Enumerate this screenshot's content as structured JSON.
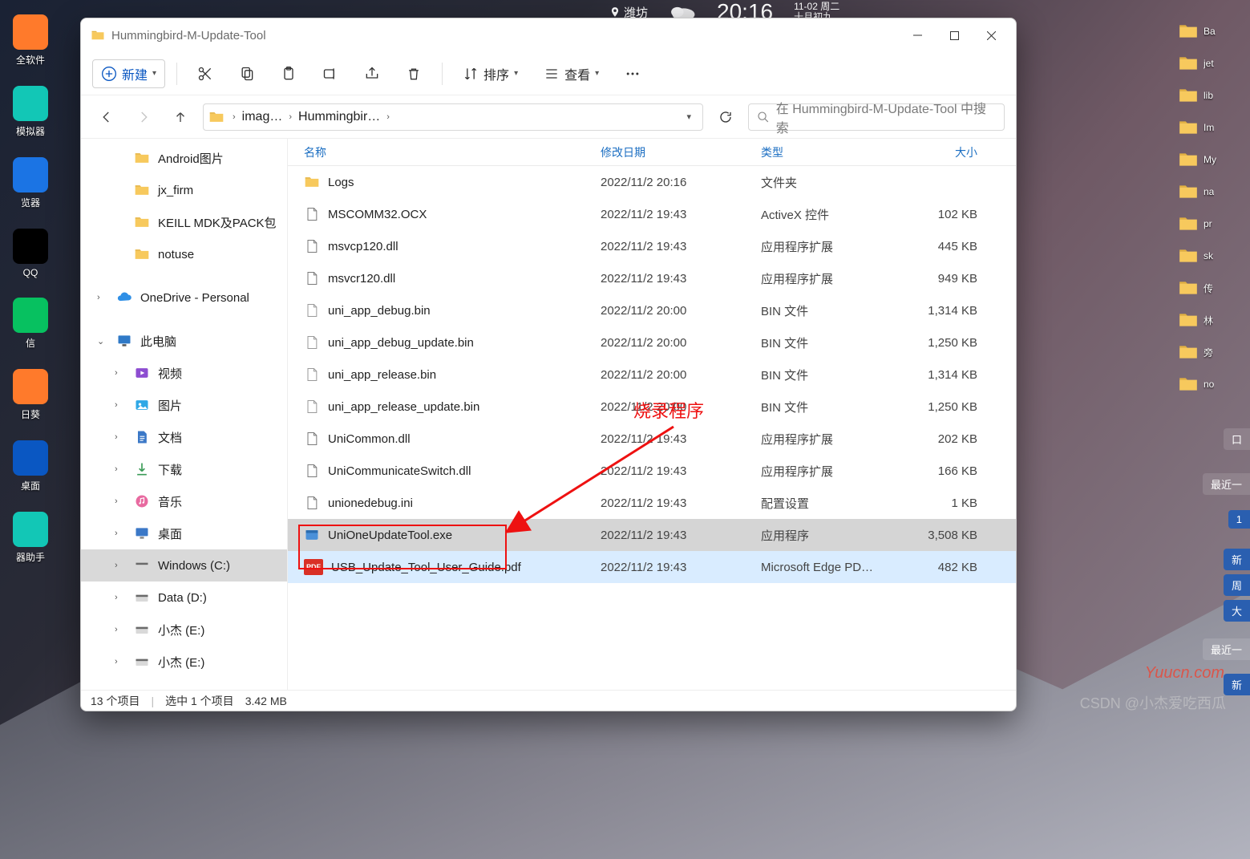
{
  "desktop_left": [
    {
      "label": "全软件",
      "color": "#ff7a2b"
    },
    {
      "label": "模拟器",
      "color": "#12c7b6"
    },
    {
      "label": "览器",
      "color": "#1b74e4"
    },
    {
      "label": "QQ",
      "color": "#000"
    },
    {
      "label": "信",
      "color": "#07c160"
    },
    {
      "label": "日葵",
      "color": "#ff7a2b"
    },
    {
      "label": "桌面",
      "color": "#0a57c2"
    },
    {
      "label": "器助手",
      "color": "#12c7b6"
    }
  ],
  "desktop_right": [
    {
      "icon": "folder",
      "label": "Ba"
    },
    {
      "icon": "folder",
      "label": "jet"
    },
    {
      "icon": "folder",
      "label": "lib"
    },
    {
      "icon": "folder",
      "label": "Im"
    },
    {
      "icon": "folder",
      "label": "My"
    },
    {
      "icon": "folder",
      "label": "na"
    },
    {
      "icon": "folder",
      "label": "pr"
    },
    {
      "icon": "folder",
      "label": "sk"
    },
    {
      "icon": "folder",
      "label": "传"
    },
    {
      "icon": "folder",
      "label": "林"
    },
    {
      "icon": "folder",
      "label": "旁"
    },
    {
      "icon": "folder",
      "label": "no"
    }
  ],
  "topbar": {
    "city": "潍坊",
    "clock": "20:16",
    "date_line1": "11-02 周二",
    "date_line2": "十月初九"
  },
  "float_tabs": {
    "contacts": "口",
    "recent": "最近一",
    "one": "1",
    "new": "新",
    "cycle": "周",
    "big": "大",
    "recent2": "最近一",
    "new2": "新"
  },
  "window": {
    "title": "Hummingbird-M-Update-Tool",
    "toolbar": {
      "new": "新建",
      "sort": "排序",
      "view": "查看"
    },
    "breadcrumb": {
      "seg1": "imag…",
      "seg2": "Hummingbir…"
    },
    "search_placeholder": "在 Hummingbird-M-Update-Tool 中搜索",
    "columns": {
      "name": "名称",
      "date": "修改日期",
      "type": "类型",
      "size": "大小"
    },
    "sidebar": {
      "folders": [
        {
          "label": "Android图片"
        },
        {
          "label": "jx_firm"
        },
        {
          "label": "KEILL MDK及PACK包"
        },
        {
          "label": "notuse"
        }
      ],
      "onedrive": "OneDrive - Personal",
      "thispc": "此电脑",
      "thispc_children": [
        {
          "icon": "video",
          "label": "视频",
          "color": "#8d4dd1"
        },
        {
          "icon": "image",
          "label": "图片",
          "color": "#2fa8e6"
        },
        {
          "icon": "doc",
          "label": "文档",
          "color": "#3b78c7"
        },
        {
          "icon": "download",
          "label": "下载",
          "color": "#3b9b57"
        },
        {
          "icon": "music",
          "label": "音乐",
          "color": "#e86aa0"
        },
        {
          "icon": "desktop",
          "label": "桌面",
          "color": "#3b78c7"
        },
        {
          "icon": "drive",
          "label": "Windows (C:)",
          "sel": true,
          "color": "#6a6a6a"
        },
        {
          "icon": "drive",
          "label": "Data (D:)",
          "color": "#6a6a6a"
        },
        {
          "icon": "drive",
          "label": "小杰 (E:)",
          "color": "#6a6a6a"
        },
        {
          "icon": "drive",
          "label": "小杰 (E:)",
          "color": "#6a6a6a"
        }
      ]
    },
    "files": [
      {
        "icon": "folder",
        "name": "Logs",
        "date": "2022/11/2 20:16",
        "type": "文件夹",
        "size": ""
      },
      {
        "icon": "ocx",
        "name": "MSCOMM32.OCX",
        "date": "2022/11/2 19:43",
        "type": "ActiveX 控件",
        "size": "102 KB"
      },
      {
        "icon": "dll",
        "name": "msvcp120.dll",
        "date": "2022/11/2 19:43",
        "type": "应用程序扩展",
        "size": "445 KB"
      },
      {
        "icon": "dll",
        "name": "msvcr120.dll",
        "date": "2022/11/2 19:43",
        "type": "应用程序扩展",
        "size": "949 KB"
      },
      {
        "icon": "bin",
        "name": "uni_app_debug.bin",
        "date": "2022/11/2 20:00",
        "type": "BIN 文件",
        "size": "1,314 KB"
      },
      {
        "icon": "bin",
        "name": "uni_app_debug_update.bin",
        "date": "2022/11/2 20:00",
        "type": "BIN 文件",
        "size": "1,250 KB"
      },
      {
        "icon": "bin",
        "name": "uni_app_release.bin",
        "date": "2022/11/2 20:00",
        "type": "BIN 文件",
        "size": "1,314 KB"
      },
      {
        "icon": "bin",
        "name": "uni_app_release_update.bin",
        "date": "2022/11/2 20:00",
        "type": "BIN 文件",
        "size": "1,250 KB"
      },
      {
        "icon": "dll",
        "name": "UniCommon.dll",
        "date": "2022/11/2 19:43",
        "type": "应用程序扩展",
        "size": "202 KB"
      },
      {
        "icon": "dll",
        "name": "UniCommunicateSwitch.dll",
        "date": "2022/11/2 19:43",
        "type": "应用程序扩展",
        "size": "166 KB"
      },
      {
        "icon": "ini",
        "name": "unionedebug.ini",
        "date": "2022/11/2 19:43",
        "type": "配置设置",
        "size": "1 KB"
      },
      {
        "icon": "exe",
        "name": "UniOneUpdateTool.exe",
        "date": "2022/11/2 19:43",
        "type": "应用程序",
        "size": "3,508 KB",
        "sel": true
      },
      {
        "icon": "pdf",
        "name": "USB_Update_Tool_User_Guide.pdf",
        "date": "2022/11/2 19:43",
        "type": "Microsoft Edge PD…",
        "size": "482 KB",
        "hover": true
      }
    ],
    "status": {
      "count": "13 个项目",
      "selected": "选中 1 个项目",
      "size": "3.42 MB"
    }
  },
  "annotation": "烧录程序",
  "watermark_y": "Yuucn.com",
  "watermark_c": "CSDN @小杰爱吃西瓜"
}
